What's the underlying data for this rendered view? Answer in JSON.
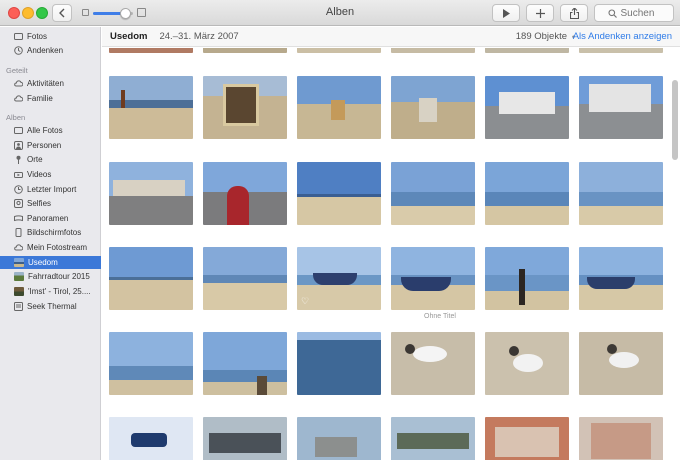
{
  "window": {
    "title": "Alben"
  },
  "toolbar": {
    "search_label": "Suchen",
    "zoom_level": 0.8,
    "back_icon": "chevron-left-icon",
    "play_icon": "play-icon",
    "add_icon": "plus-icon",
    "share_icon": "share-icon"
  },
  "sidebar": {
    "top_items": [
      {
        "label": "Fotos",
        "icon": "photos-icon"
      },
      {
        "label": "Andenken",
        "icon": "memories-icon"
      }
    ],
    "shared_header": "Geteilt",
    "shared_items": [
      {
        "label": "Aktivitäten",
        "icon": "cloud-icon"
      },
      {
        "label": "Familie",
        "icon": "cloud-icon"
      }
    ],
    "albums_header": "Alben",
    "album_items": [
      {
        "label": "Alle Fotos",
        "icon": "photos-icon"
      },
      {
        "label": "Personen",
        "icon": "person-icon"
      },
      {
        "label": "Orte",
        "icon": "pin-icon"
      },
      {
        "label": "Videos",
        "icon": "video-icon"
      },
      {
        "label": "Letzter Import",
        "icon": "clock-icon"
      },
      {
        "label": "Selfies",
        "icon": "selfie-icon"
      },
      {
        "label": "Panoramen",
        "icon": "panorama-icon"
      },
      {
        "label": "Bildschirmfotos",
        "icon": "screenshot-icon"
      },
      {
        "label": "Mein Fotostream",
        "icon": "cloud-icon"
      },
      {
        "label": "Usedom",
        "icon": "album-thumbnail",
        "selected": true
      },
      {
        "label": "Fahrradtour 2015",
        "icon": "album-thumbnail"
      },
      {
        "label": "'Imst' - Tirol, 25....",
        "icon": "album-thumbnail"
      },
      {
        "label": "Seek Thermal",
        "icon": "folder-icon"
      }
    ]
  },
  "header": {
    "title": "Usedom",
    "date": "24.–31. März 2007",
    "count": "189 Objekte",
    "separator": "•",
    "memory_link": "Als Andenken anzeigen"
  },
  "grid": {
    "caption": "Ohne Titel",
    "heart_icon": "heart-icon"
  },
  "colors": {
    "accent": "#3b78d8",
    "link": "#2f7ce8",
    "sidebar_bg": "#e9e9ed"
  }
}
